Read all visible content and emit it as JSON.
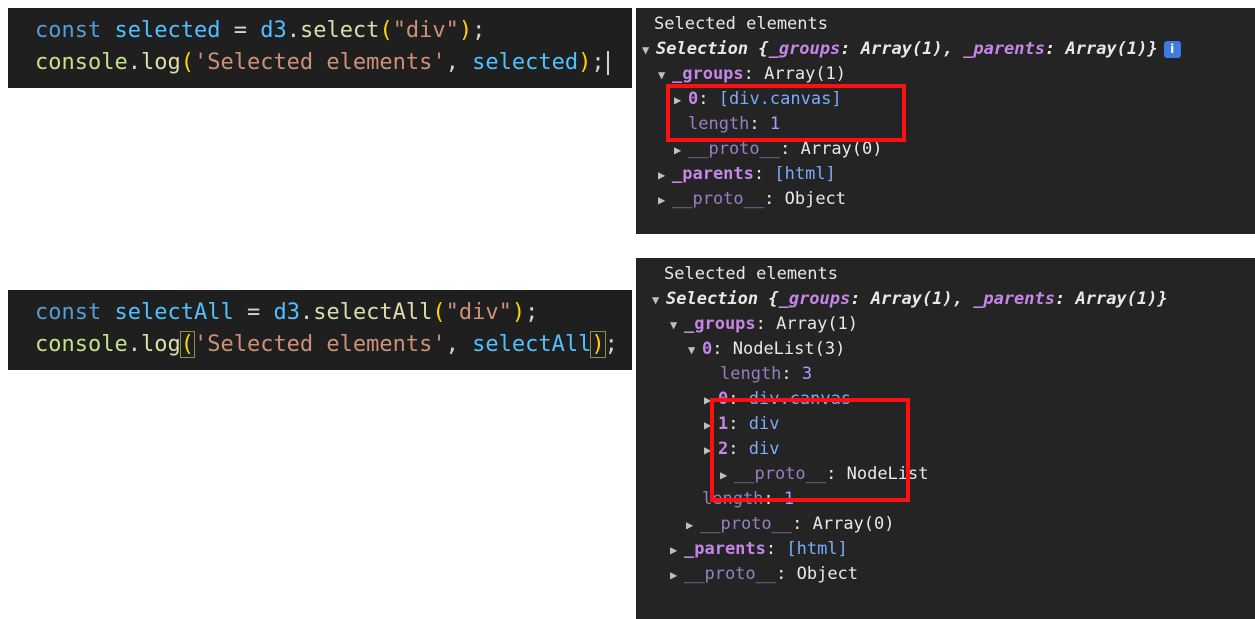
{
  "code1": {
    "kw": "const",
    "var": "selected",
    "op": " = ",
    "obj": "d3",
    "fn": "select",
    "arg": "\"div\"",
    "console": "console",
    "log": "log",
    "label": "'Selected elements'",
    "sep": ", ",
    "logvar": "selected"
  },
  "code2": {
    "kw": "const",
    "var": "selectAll",
    "op": " = ",
    "obj": "d3",
    "fn": "selectAll",
    "arg": "\"div\"",
    "console": "console",
    "log": "log",
    "label": "'Selected elements'",
    "sep": ", ",
    "logvar": "selectAll"
  },
  "console1": {
    "header": "Selected elements",
    "summary_prefix": "Selection {",
    "summary_groups_key": "_groups",
    "summary_groups_val": "Array(1)",
    "summary_parents_key": "_parents",
    "summary_parents_val": "Array(1)",
    "summary_suffix": "}",
    "groups_key": "_groups",
    "groups_val": "Array(1)",
    "item0_key": "0",
    "item0_val": "[div.canvas]",
    "length_key": "length",
    "length_val": "1",
    "proto1_key": "__proto__",
    "proto1_val": "Array(0)",
    "parents_key": "_parents",
    "parents_val": "[html]",
    "proto2_key": "__proto__",
    "proto2_val": "Object",
    "info_icon": "i"
  },
  "console2": {
    "header": "Selected elements",
    "summary_prefix": "Selection {",
    "summary_groups_key": "_groups",
    "summary_groups_val": "Array(1)",
    "summary_parents_key": "_parents",
    "summary_parents_val": "Array(1)",
    "summary_suffix": "}",
    "groups_key": "_groups",
    "groups_val": "Array(1)",
    "nodelist_key": "0",
    "nodelist_val": "NodeList(3)",
    "nl_length_key": "length",
    "nl_length_val": "3",
    "nodes": [
      {
        "key": "0",
        "val": "div.canvas"
      },
      {
        "key": "1",
        "val": "div"
      },
      {
        "key": "2",
        "val": "div"
      }
    ],
    "nl_proto_key": "__proto__",
    "nl_proto_val": "NodeList",
    "length_key": "length",
    "length_val": "1",
    "proto1_key": "__proto__",
    "proto1_val": "Array(0)",
    "parents_key": "_parents",
    "parents_val": "[html]",
    "proto2_key": "__proto__",
    "proto2_val": "Object"
  },
  "colors": {
    "highlight": "#ff1010",
    "editor_bg": "#1f1f1f",
    "console_bg": "#242424"
  }
}
